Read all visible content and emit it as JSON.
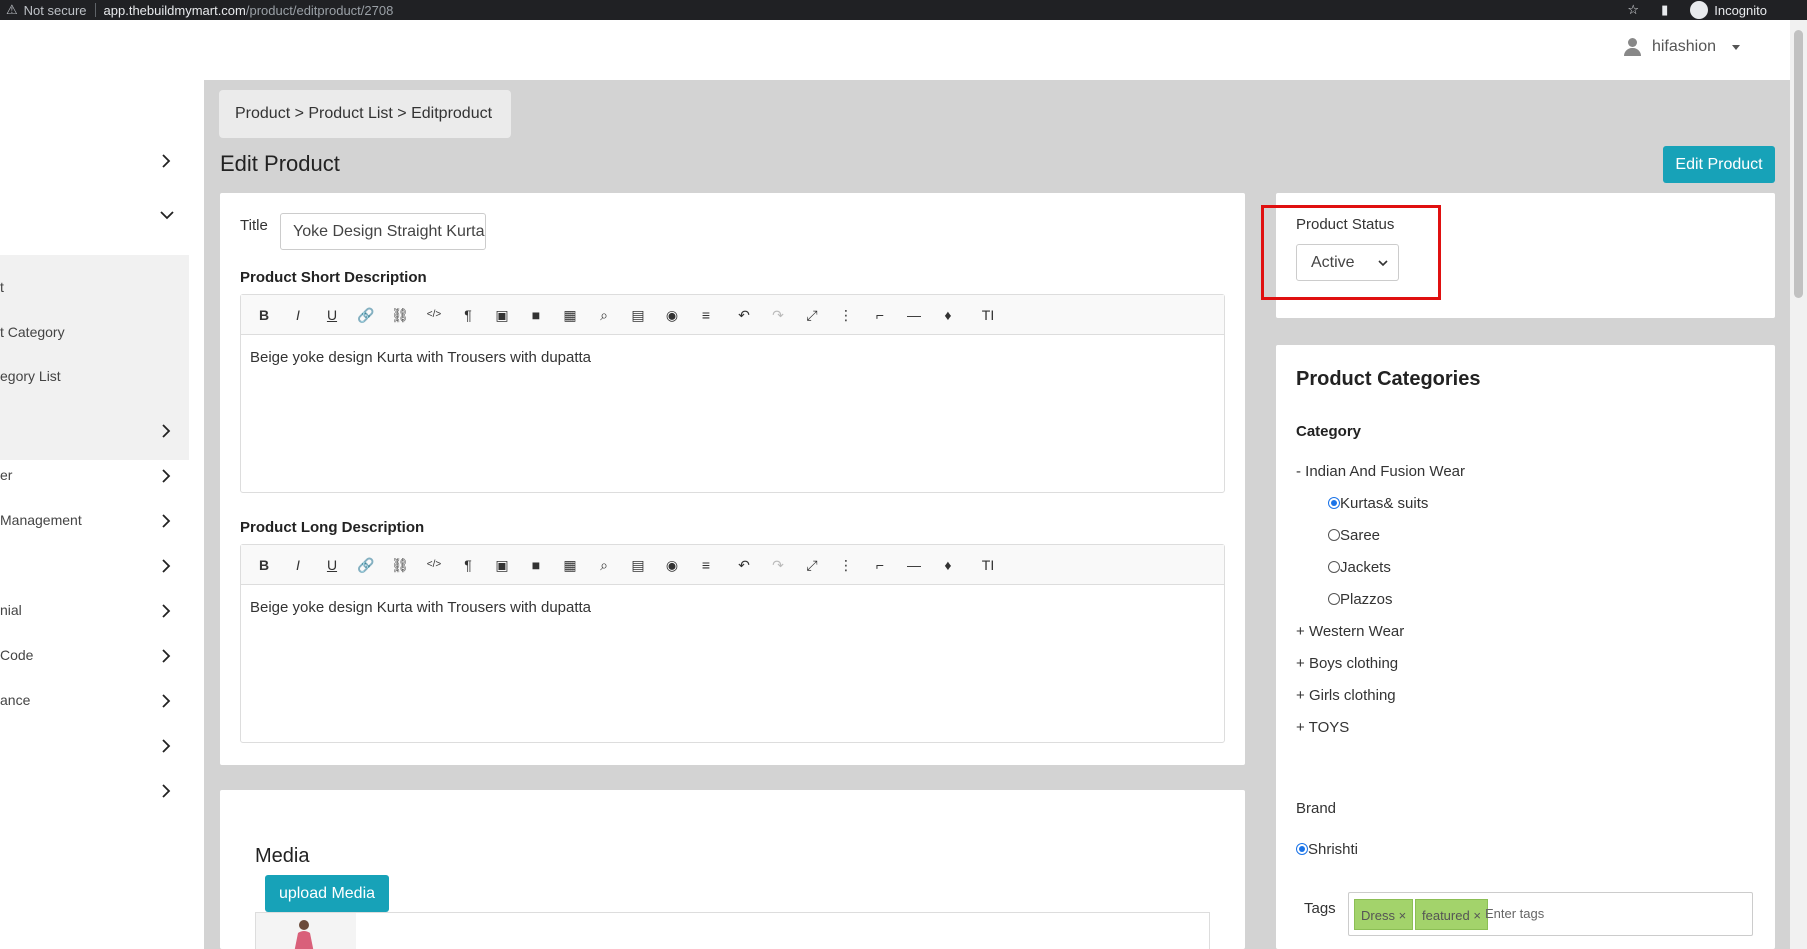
{
  "browser": {
    "security": "Not secure",
    "url_host": "app.thebuildmymart.com",
    "url_path": "/product/editproduct/2708",
    "incognito": "Incognito"
  },
  "header": {
    "username": "hifashion"
  },
  "sidebar": {
    "items": [
      {
        "label": "",
        "chevron": "right"
      },
      {
        "label": "",
        "chevron": "down"
      },
      {
        "label": "t",
        "chevron": ""
      },
      {
        "label": "t Category",
        "chevron": ""
      },
      {
        "label": "egory List",
        "chevron": ""
      },
      {
        "label": "",
        "chevron": "right"
      },
      {
        "label": "er",
        "chevron": "right"
      },
      {
        "label": " Management",
        "chevron": "right"
      },
      {
        "label": "",
        "chevron": "right"
      },
      {
        "label": "nial",
        "chevron": "right"
      },
      {
        "label": " Code",
        "chevron": "right"
      },
      {
        "label": "ance",
        "chevron": "right"
      },
      {
        "label": "",
        "chevron": "right"
      },
      {
        "label": "",
        "chevron": "right"
      }
    ]
  },
  "breadcrumb": "Product > Product List > Editproduct",
  "page_title": "Edit Product",
  "edit_button": "Edit Product",
  "form": {
    "title_label": "Title",
    "title_value": "Yoke Design Straight Kurta",
    "short_desc_label": "Product Short Description",
    "short_desc_value": "Beige yoke design Kurta with Trousers with dupatta",
    "long_desc_label": "Product Long Description",
    "long_desc_value": "Beige yoke design Kurta with Trousers with dupatta"
  },
  "toolbar_icons": [
    "bold-icon",
    "italic-icon",
    "underline-icon",
    "link-icon",
    "unlink-icon",
    "code-view-icon",
    "paragraph-icon",
    "image-icon",
    "video-icon",
    "table-icon",
    "search-icon",
    "template-icon",
    "preview-icon",
    "align-icon",
    "undo-icon",
    "redo-icon",
    "fullscreen-icon",
    "more-icon",
    "format-painter-icon",
    "horizontal-rule-icon",
    "color-icon",
    "font-size-icon"
  ],
  "status": {
    "label": "Product Status",
    "value": "Active"
  },
  "categories": {
    "title": "Product Categories",
    "category_label": "Category",
    "tree": [
      {
        "prefix": "-",
        "label": "Indian And Fusion Wear",
        "children": [
          {
            "label": "Kurtas& suits",
            "checked": true
          },
          {
            "label": "Saree",
            "checked": false
          },
          {
            "label": "Jackets",
            "checked": false
          },
          {
            "label": "Plazzos",
            "checked": false
          }
        ]
      },
      {
        "prefix": "+",
        "label": "Western Wear"
      },
      {
        "prefix": "+",
        "label": "Boys clothing"
      },
      {
        "prefix": "+",
        "label": "Girls clothing"
      },
      {
        "prefix": "+",
        "label": "TOYS"
      }
    ],
    "brand_label": "Brand",
    "brand_value": "Shrishti",
    "tags_label": "Tags",
    "tags": [
      "Dress",
      "featured"
    ],
    "tags_placeholder": "Enter tags"
  },
  "media": {
    "title": "Media",
    "upload_button": "upload Media"
  },
  "colors": {
    "accent": "#17a2b8",
    "highlight": "#e01010",
    "tag_bg": "#a3d36b"
  }
}
